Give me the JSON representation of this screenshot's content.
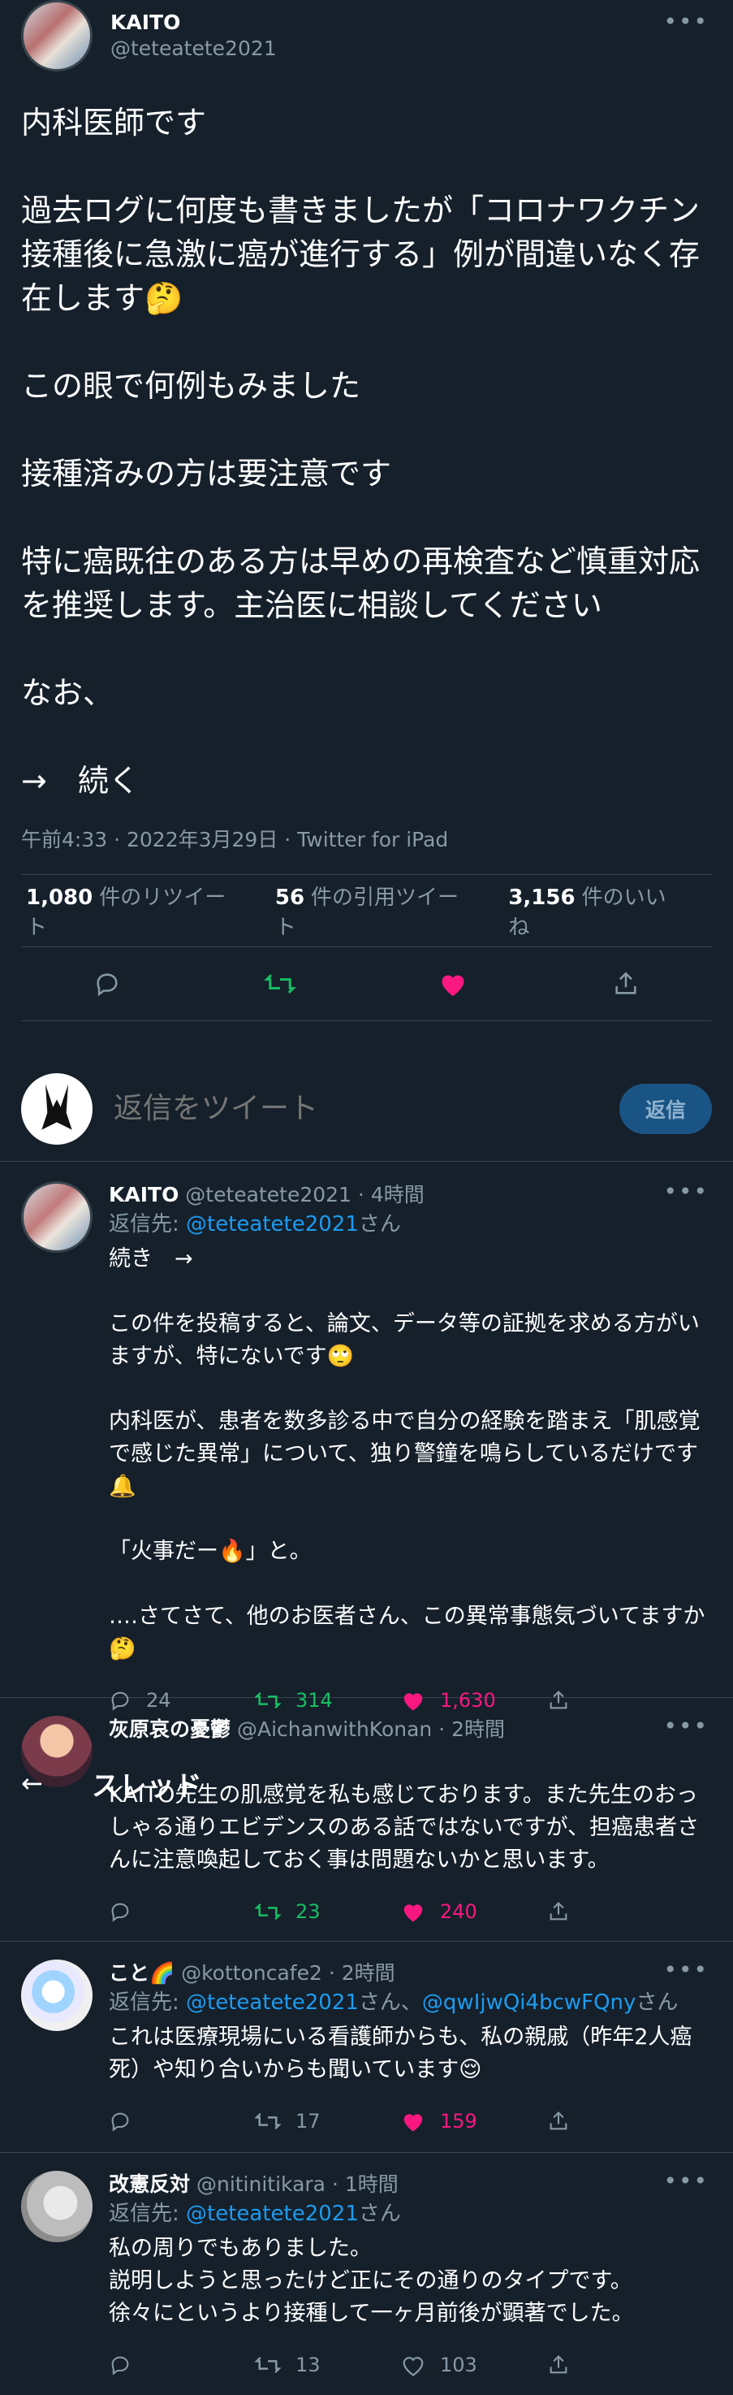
{
  "main_tweet": {
    "name": "KAITO",
    "handle": "@teteatete2021",
    "body": "内科医師です\n\n過去ログに何度も書きましたが「コロナワクチン接種後に急激に癌が進行する」例が間違いなく存在します🤔\n\nこの眼で何例もみました\n\n接種済みの方は要注意です\n\n特に癌既往のある方は早めの再検査など慎重対応を推奨します。主治医に相談してください\n\nなお、\n\n→　続く",
    "meta": "午前4:33 · 2022年3月29日 · Twitter for iPad",
    "stats": [
      {
        "num": "1,080",
        "label": "件のリツイート"
      },
      {
        "num": "56",
        "label": "件の引用ツイート"
      },
      {
        "num": "3,156",
        "label": "件のいいね"
      }
    ],
    "actions": [
      "reply-icon",
      "retweet-icon",
      "like-icon",
      "share-icon"
    ]
  },
  "composer": {
    "placeholder": "返信をツイート",
    "button": "返信"
  },
  "thread_header": {
    "back": "←",
    "title": "スレッド"
  },
  "replies": [
    {
      "name": "KAITO",
      "handle": "@teteatete2021",
      "time": "· 4時間",
      "reply_to_prefix": "返信先: ",
      "reply_to": "@teteatete2021",
      "reply_to_suffix": "さん",
      "body": "続き　→\n\nこの件を投稿すると、論文、データ等の証拠を求める方がいますが、特にないです🙄\n\n内科医が、患者を数多診る中で自分の経験を踏まえ「肌感覚で感じた異常」について、独り警鐘を鳴らしているだけです🔔\n\n「火事だー🔥」と。\n\n‥‥さてさて、他のお医者さん、この異常事態気づいてますか🤔",
      "counts": {
        "reply": "24",
        "retweet": "314",
        "like": "1,630"
      }
    },
    {
      "name": "灰原哀の憂鬱",
      "handle": "@AichanwithKonan",
      "time": "· 2時間",
      "body": "KAITO先生の肌感覚を私も感じております。また先生のおっしゃる通りエビデンスのある話ではないですが、担癌患者さんに注意喚起しておく事は問題ないかと思います。",
      "counts": {
        "reply": "",
        "retweet": "23",
        "like": "240"
      }
    },
    {
      "name": "こと🌈",
      "handle": "@kottoncafe2",
      "time": "· 2時間",
      "reply_to_prefix": "返信先: ",
      "reply_to": "@teteatete2021",
      "reply_to_mid": "さん、",
      "reply_to2": "@qwIjwQi4bcwFQny",
      "reply_to_suffix": "さん",
      "body": "これは医療現場にいる看護師からも、私の親戚（昨年2人癌死）や知り合いからも聞いています😌",
      "counts": {
        "reply": "",
        "retweet": "17",
        "like": "159"
      }
    },
    {
      "name": "改憲反対",
      "handle": "@nitinitikara",
      "time": "· 1時間",
      "reply_to_prefix": "返信先: ",
      "reply_to": "@teteatete2021",
      "reply_to_suffix": "さん",
      "body": "私の周りでもありました。\n説明しようと思ったけど正にその通りのタイプです。\n徐々にというより接種して一ヶ月前後が顕著でした。",
      "counts": {
        "reply": "",
        "retweet": "13",
        "like": "103"
      }
    }
  ],
  "colors": {
    "background": "#15202b",
    "accent": "#1d9bf0",
    "like": "#f91880",
    "retweet": "#17bf63",
    "muted": "#8899a6"
  }
}
